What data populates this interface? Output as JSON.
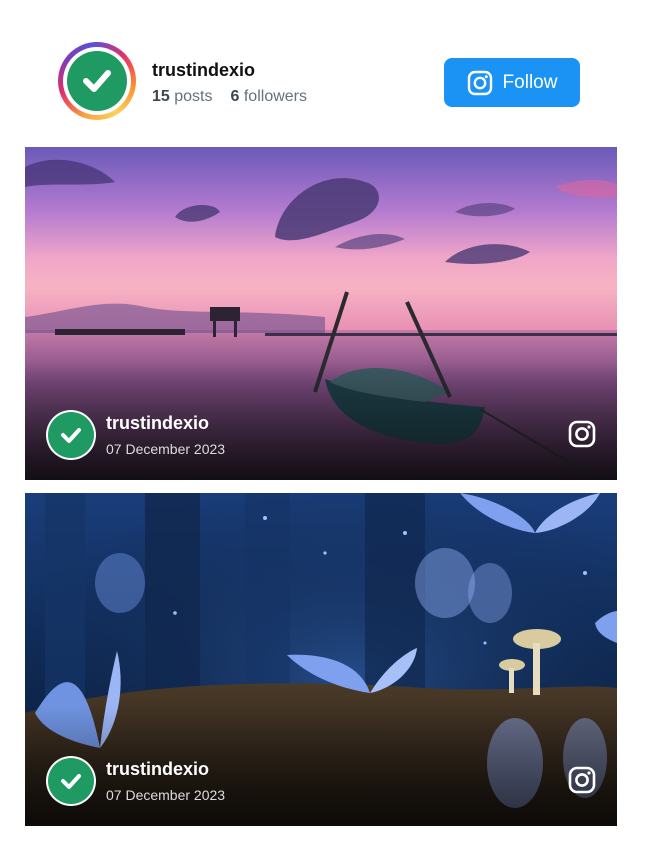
{
  "profile": {
    "username": "trustindexio",
    "posts_count": "15",
    "posts_label": "posts",
    "followers_count": "6",
    "followers_label": "followers",
    "follow_label": "Follow",
    "accent_color": "#1a93f5",
    "avatar_color": "#1e9a62"
  },
  "posts": [
    {
      "username": "trustindexio",
      "date": "07 December 2023",
      "icon": "instagram-icon"
    },
    {
      "username": "trustindexio",
      "date": "07 December 2023",
      "icon": "instagram-icon"
    }
  ]
}
